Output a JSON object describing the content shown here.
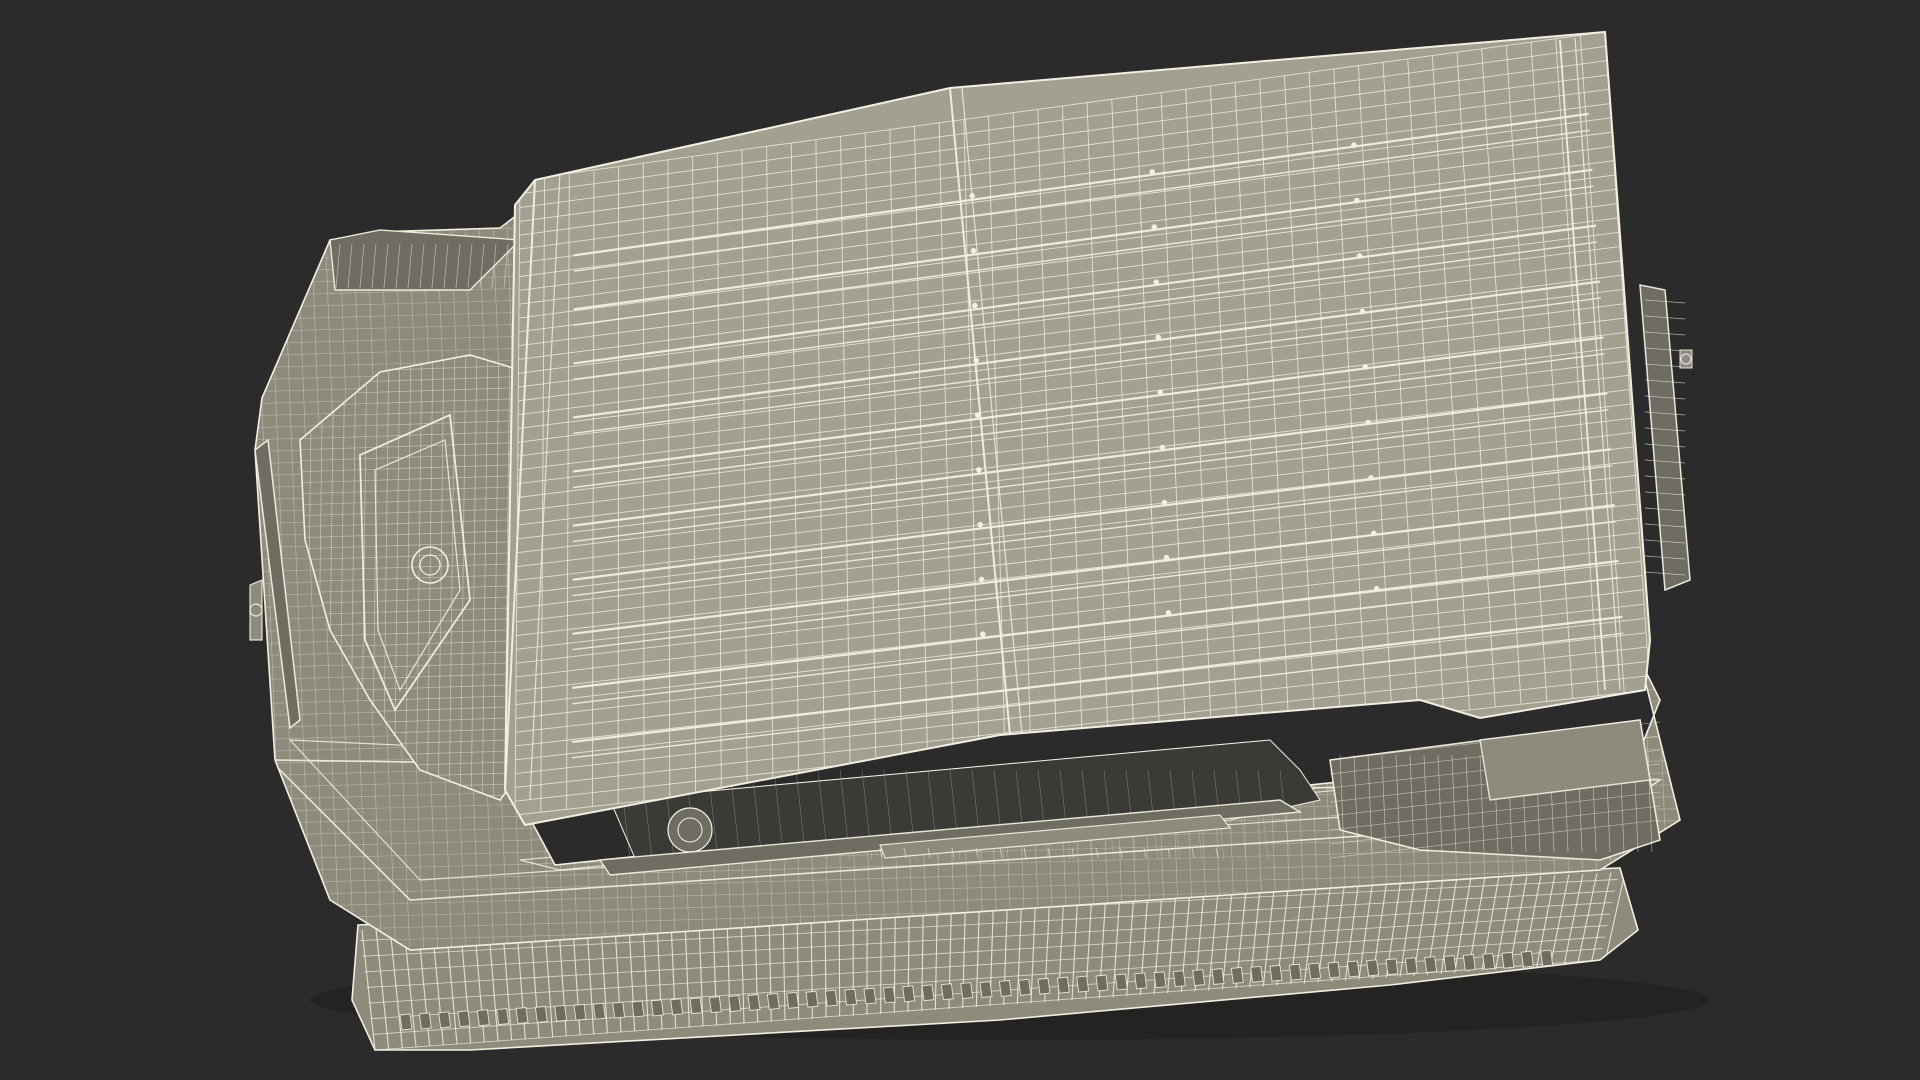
{
  "scene": {
    "subject": "wireframe-tracked-vehicle-top-view",
    "colors": {
      "background": "#2b2b2b",
      "surface": "#8e8b7c",
      "surface_dark": "#6f6d61",
      "surface_light": "#a3a091",
      "wire": "#f2efe2",
      "shadow": "#1b1b1a",
      "cavity": "#3a3a36"
    }
  }
}
